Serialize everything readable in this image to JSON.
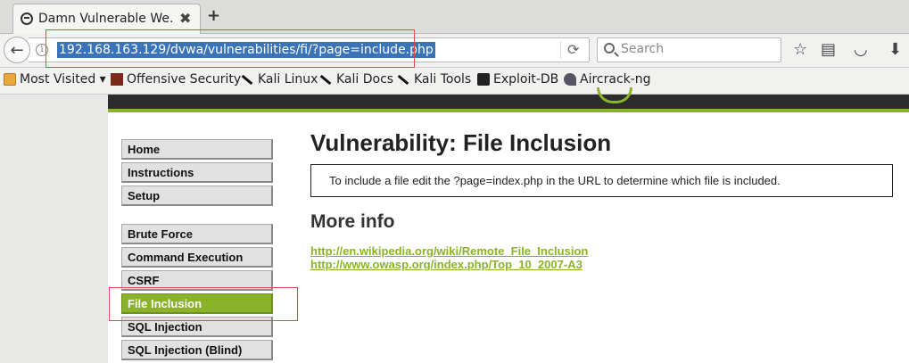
{
  "browser": {
    "tab_title": "Damn Vulnerable We...",
    "tab_close": "✖",
    "new_tab": "+",
    "back": "←",
    "info": "i",
    "url": "192.168.163.129/dvwa/vulnerabilities/fi/?page=include.php",
    "reload": "⟳",
    "search_placeholder": "Search",
    "toolbar_icons": {
      "bookmark_star": "☆",
      "reading_list": "▤",
      "pocket": "◡",
      "downloads": "⬇"
    }
  },
  "bookmarks": [
    {
      "label": "Most Visited ▾",
      "icon": "folder-icon"
    },
    {
      "label": "Offensive Security",
      "icon": "offsec-icon"
    },
    {
      "label": "Kali Linux",
      "icon": "kali-icon"
    },
    {
      "label": "Kali Docs",
      "icon": "kali-icon"
    },
    {
      "label": "Kali Tools",
      "icon": "kali-icon"
    },
    {
      "label": "Exploit-DB",
      "icon": "exploitdb-icon"
    },
    {
      "label": "Aircrack-ng",
      "icon": "aircrack-icon"
    }
  ],
  "menu": {
    "group1": [
      "Home",
      "Instructions",
      "Setup"
    ],
    "group2": [
      "Brute Force",
      "Command Execution",
      "CSRF",
      "File Inclusion",
      "SQL Injection",
      "SQL Injection (Blind)"
    ],
    "active": "File Inclusion"
  },
  "main": {
    "title": "Vulnerability: File Inclusion",
    "box_text": "To include a file edit the ?page=index.php in the URL to determine which file is included.",
    "more_info_heading": "More info",
    "links": [
      "http://en.wikipedia.org/wiki/Remote_File_Inclusion",
      "http://www.owasp.org/index.php/Top_10_2007-A3"
    ]
  },
  "colors": {
    "accent_green": "#8ab32b",
    "annotation_red": "#e24a4a",
    "url_selection": "#3b73b9"
  }
}
